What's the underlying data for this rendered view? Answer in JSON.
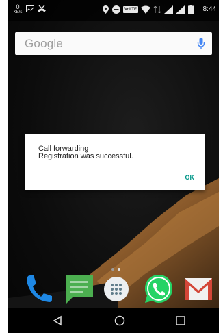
{
  "status_bar": {
    "speed_value": "0",
    "speed_unit": "KB/s",
    "clock": "8:44",
    "icons": [
      "image-icon",
      "missed-call-icon",
      "location-icon",
      "do-not-disturb-icon",
      "volte-icon",
      "wifi-icon",
      "signal-icon",
      "signal-icon",
      "battery-icon"
    ],
    "volte_label": "VoLTE"
  },
  "search_widget": {
    "logo_text": "Google",
    "icon": "mic-icon"
  },
  "dialog": {
    "message": "Call forwarding\nRegistration was successful.",
    "ok_label": "OK"
  },
  "dock": {
    "apps": [
      "phone-icon",
      "messaging-icon",
      "app-drawer-icon",
      "whatsapp-icon",
      "gmail-icon"
    ]
  },
  "nav_bar": {
    "buttons": [
      "back-icon",
      "home-icon",
      "recents-icon"
    ]
  },
  "colors": {
    "accent": "#009688",
    "search_bg": "#fafafa",
    "mic": "#4285f4",
    "whatsapp": "#25d366",
    "messages": "#4caf50",
    "gmail": "#d44638",
    "phone": "#1e88e5"
  }
}
